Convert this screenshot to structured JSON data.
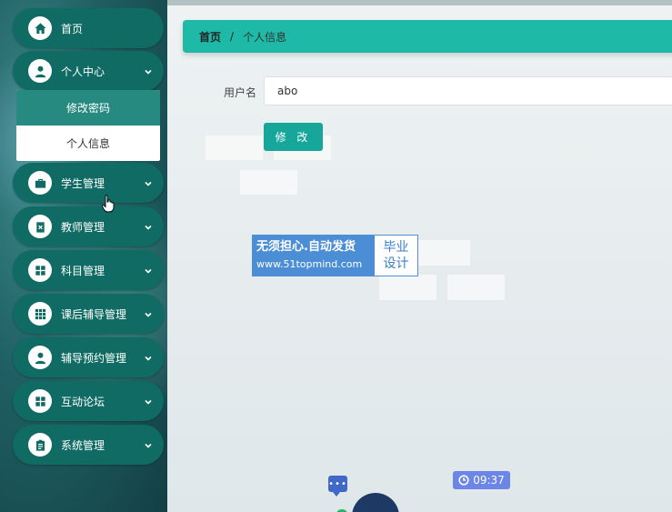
{
  "sidebar": {
    "items": [
      {
        "label": "首页",
        "icon": "home-icon",
        "has_chevron": false
      },
      {
        "label": "个人中心",
        "icon": "user-icon",
        "has_chevron": true
      },
      {
        "label": "学生管理",
        "icon": "briefcase-icon",
        "has_chevron": true
      },
      {
        "label": "教师管理",
        "icon": "clipboard-x-icon",
        "has_chevron": true
      },
      {
        "label": "科目管理",
        "icon": "grid-icon",
        "has_chevron": true
      },
      {
        "label": "课后辅导管理",
        "icon": "apps-icon",
        "has_chevron": true
      },
      {
        "label": "辅导预约管理",
        "icon": "user-icon",
        "has_chevron": true
      },
      {
        "label": "互动论坛",
        "icon": "grid-icon",
        "has_chevron": true
      },
      {
        "label": "系统管理",
        "icon": "clipboard-icon",
        "has_chevron": true
      }
    ],
    "submenu": [
      {
        "label": "修改密码",
        "active": true
      },
      {
        "label": "个人信息",
        "active": false
      }
    ]
  },
  "breadcrumb": {
    "home": "首页",
    "separator": "/",
    "current": "个人信息"
  },
  "form": {
    "username_label": "用户名",
    "username_value": "abo",
    "submit_label": "修 改"
  },
  "watermark": {
    "line1": "无须担心.自动发货",
    "line2": "www.51topmind.com",
    "right_line1": "毕业",
    "right_line2": "设计"
  },
  "clock": {
    "time": "09:37"
  },
  "colors": {
    "sidebar_item_bg": "#0f6b63",
    "breadcrumb_bg": "#1fb9a8",
    "submenu_active_bg": "#268a80",
    "button_bg": "#16a79a",
    "watermark_blue": "#4b8ed5"
  }
}
